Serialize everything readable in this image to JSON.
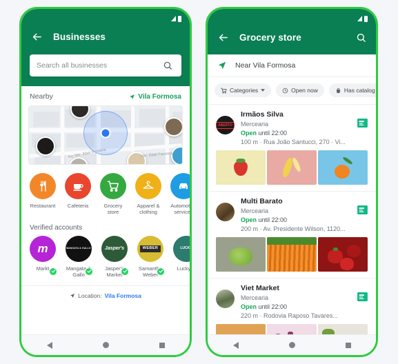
{
  "left_phone": {
    "statusbar": {
      "signal_icon": "signal-bars-icon",
      "battery_icon": "battery-icon"
    },
    "appbar": {
      "back_icon": "back-arrow-icon",
      "title": "Businesses"
    },
    "search": {
      "placeholder": "Search all businesses",
      "value": "",
      "icon": "search-icon"
    },
    "nearby": {
      "title": "Nearby",
      "location_label": "Vila Formosa",
      "location_icon": "navigation-arrow-icon",
      "map": {
        "streets": [
          "Av. Ver. Abel Ferreira",
          "Ver. Abel Ferreira"
        ],
        "pins": [
          {
            "name": "map-pin-1",
            "color": "#2b2a28"
          },
          {
            "name": "map-pin-2",
            "color": "#7d6a52"
          },
          {
            "name": "map-pin-3",
            "color": "#1c1b19"
          },
          {
            "name": "map-pin-4",
            "color": "#3e9fd0"
          },
          {
            "name": "map-pin-5",
            "color": "#d9c9a8"
          },
          {
            "name": "map-pin-6",
            "color": "#c9a3a8"
          }
        ]
      }
    },
    "categories": [
      {
        "label": "Restaurant",
        "icon": "cutlery-icon",
        "color": "#f2872a"
      },
      {
        "label": "Cafeteria",
        "icon": "coffee-icon",
        "color": "#e8462d"
      },
      {
        "label": "Grocery store",
        "icon": "shopping-cart-icon",
        "color": "#35a93f"
      },
      {
        "label": "Apparel & clothing",
        "icon": "clothes-hanger-icon",
        "color": "#f0b018"
      },
      {
        "label": "Automotive services",
        "icon": "car-icon",
        "color": "#1e9de3"
      }
    ],
    "verified": {
      "title": "Verified accounts",
      "accounts": [
        {
          "label": "Markt",
          "mark": "m",
          "color": "#b524d6",
          "verified": true
        },
        {
          "label": "Mangata & Gallo",
          "mark": "MANGATA & GALLO",
          "color": "#111111",
          "verified": true
        },
        {
          "label": "Jasper's Market",
          "mark": "Jasper's",
          "color": "#2d5b38",
          "verified": true
        },
        {
          "label": "Samantha Weber",
          "mark": "WEBER",
          "color": "#d7bc34",
          "verified": true
        },
        {
          "label": "Lucky S",
          "mark": "LUCKY",
          "color": "#2d7a6e",
          "verified": true
        }
      ]
    },
    "footer": {
      "prefix": "Location:",
      "location": "Vila Formosa",
      "icon": "navigation-arrow-icon"
    },
    "navbar": {
      "back_icon": "nav-back-icon",
      "home_icon": "nav-home-icon",
      "recents_icon": "nav-recents-icon"
    }
  },
  "right_phone": {
    "statusbar": {
      "signal_icon": "signal-bars-icon",
      "battery_icon": "battery-icon"
    },
    "appbar": {
      "back_icon": "back-arrow-icon",
      "title": "Grocery store",
      "search_icon": "search-icon"
    },
    "near_bar": {
      "icon": "navigation-arrow-icon",
      "text": "Near Vila Formosa"
    },
    "chips": [
      {
        "label": "Categories",
        "icon": "shopping-cart-icon",
        "has_caret": true
      },
      {
        "label": "Open now",
        "icon": "clock-icon",
        "has_caret": false
      },
      {
        "label": "Has catalog",
        "icon": "catalog-bag-icon",
        "has_caret": false
      }
    ],
    "listings": [
      {
        "name": "Irmãos Silva",
        "category": "Mercearia",
        "status": "Open",
        "hours": "until 22:00",
        "address": "100 m · Rua João Santucci, 270 · Vi...",
        "avatar_color": "#1a1a1a",
        "avatar_mark": "ABERTO",
        "catalog_icon": "catalog-icon",
        "thumbnails": [
          {
            "name": "strawberry-photo",
            "bg": "#efeab6",
            "item": "#d8352c",
            "item2": "#4f9c3a"
          },
          {
            "name": "banana-photo",
            "bg": "#e8aaa3",
            "item": "#f0d24e",
            "item2": "#f6e59a"
          },
          {
            "name": "tangerine-photo",
            "bg": "#79c5e8",
            "item": "#f08521",
            "item2": "#3f8a3a"
          }
        ]
      },
      {
        "name": "Multi Barato",
        "category": "Mercearia",
        "status": "Open",
        "hours": "until 22:00",
        "address": "200 m · Av. Presidente Wilson, 1120...",
        "avatar_color": "#6e5334",
        "avatar_mark": "",
        "catalog_icon": "catalog-icon",
        "thumbnails": [
          {
            "name": "lettuce-photo",
            "bg": "#9aa08c",
            "item": "#7cb83f",
            "item2": "#a9cf63"
          },
          {
            "name": "carrots-photo",
            "bg": "#e8771c",
            "item": "#f2922c",
            "item2": "#4a8a2c"
          },
          {
            "name": "peppers-photo",
            "bg": "#8f1414",
            "item": "#c21f1f",
            "item2": "#3f8a3a"
          }
        ]
      },
      {
        "name": "Viet Market",
        "category": "Mercearia",
        "status": "Open",
        "hours": "until 22:00",
        "address": "220 m · Rodovia Raposo Tavares...",
        "avatar_color": "#7d8c6a",
        "avatar_mark": "",
        "catalog_icon": "catalog-icon",
        "thumbnails": [
          {
            "name": "bread-rolls-photo",
            "bg": "#e0a356",
            "item": "#f0d9a8",
            "item2": "#c97f32"
          },
          {
            "name": "pink-bottles-photo",
            "bg": "#f0dbe6",
            "item": "#a8437d",
            "item2": "#ffffff"
          },
          {
            "name": "fruit-plates-photo",
            "bg": "#e8e4dc",
            "item": "#6f9e3a",
            "item2": "#e8941f"
          }
        ]
      }
    ],
    "navbar": {
      "back_icon": "nav-back-icon",
      "home_icon": "nav-home-icon",
      "recents_icon": "nav-recents-icon"
    }
  }
}
